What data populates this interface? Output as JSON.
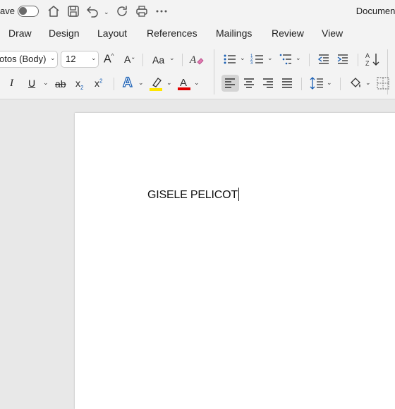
{
  "titlebar": {
    "autosave_label": "ave",
    "document_title": "Document"
  },
  "tabs": [
    {
      "label": "Draw"
    },
    {
      "label": "Design"
    },
    {
      "label": "Layout"
    },
    {
      "label": "References"
    },
    {
      "label": "Mailings"
    },
    {
      "label": "Review"
    },
    {
      "label": "View"
    }
  ],
  "ribbon": {
    "font_name": "otos (Body)",
    "font_size": "12",
    "grow_font": "A",
    "shrink_font": "A",
    "change_case": "Aa",
    "italic": "I",
    "underline": "U",
    "strikethrough": "ab",
    "subscript": "x",
    "superscript": "x",
    "text_effects": "A",
    "font_color": "A",
    "highlight_color": "#ffe600",
    "font_color_value": "#e00000"
  },
  "document": {
    "text": "GISELE PELICOT"
  }
}
